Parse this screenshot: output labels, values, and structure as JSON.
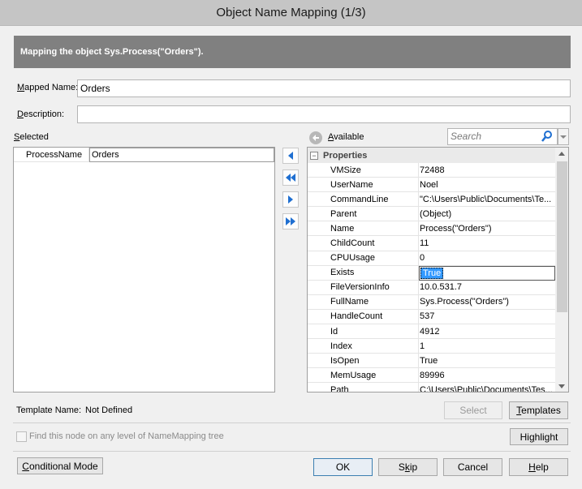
{
  "window": {
    "title": "Object Name Mapping (1/3)"
  },
  "banner": {
    "text": "Mapping the object Sys.Process(\"Orders\")."
  },
  "mapped_name": {
    "label": "Mapped Name:",
    "value": "Orders"
  },
  "description": {
    "label": "Description:",
    "value": ""
  },
  "selected": {
    "label": "Selected",
    "rows": [
      {
        "name": "ProcessName",
        "value": "Orders"
      }
    ]
  },
  "available": {
    "label": "Available",
    "search_placeholder": "Search",
    "group_label": "Properties",
    "properties": [
      {
        "name": "VMSize",
        "value": "72488"
      },
      {
        "name": "UserName",
        "value": "Noel"
      },
      {
        "name": "CommandLine",
        "value": "\"C:\\Users\\Public\\Documents\\Te..."
      },
      {
        "name": "Parent",
        "value": "(Object)"
      },
      {
        "name": "Name",
        "value": "Process(\"Orders\")"
      },
      {
        "name": "ChildCount",
        "value": "11"
      },
      {
        "name": "CPUUsage",
        "value": "0"
      },
      {
        "name": "Exists",
        "value": "True"
      },
      {
        "name": "FileVersionInfo",
        "value": "10.0.531.7"
      },
      {
        "name": "FullName",
        "value": "Sys.Process(\"Orders\")"
      },
      {
        "name": "HandleCount",
        "value": "537"
      },
      {
        "name": "Id",
        "value": "4912"
      },
      {
        "name": "Index",
        "value": "1"
      },
      {
        "name": "IsOpen",
        "value": "True"
      },
      {
        "name": "MemUsage",
        "value": "89996"
      },
      {
        "name": "Path",
        "value": "C:\\Users\\Public\\Documents\\Tes..."
      }
    ]
  },
  "template": {
    "label": "Template Name:",
    "value": "Not Defined"
  },
  "buttons": {
    "select": "Select",
    "templates": "Templates",
    "highlight": "Highlight",
    "conditional": "Conditional Mode",
    "ok": "OK",
    "skip": "Skip",
    "cancel": "Cancel",
    "help": "Help"
  },
  "find_node": {
    "label": "Find this node on any level of NameMapping tree",
    "checked": false
  },
  "colors": {
    "accent": "#3399ff",
    "banner": "#808080",
    "arrow": "#1f6fd1"
  }
}
